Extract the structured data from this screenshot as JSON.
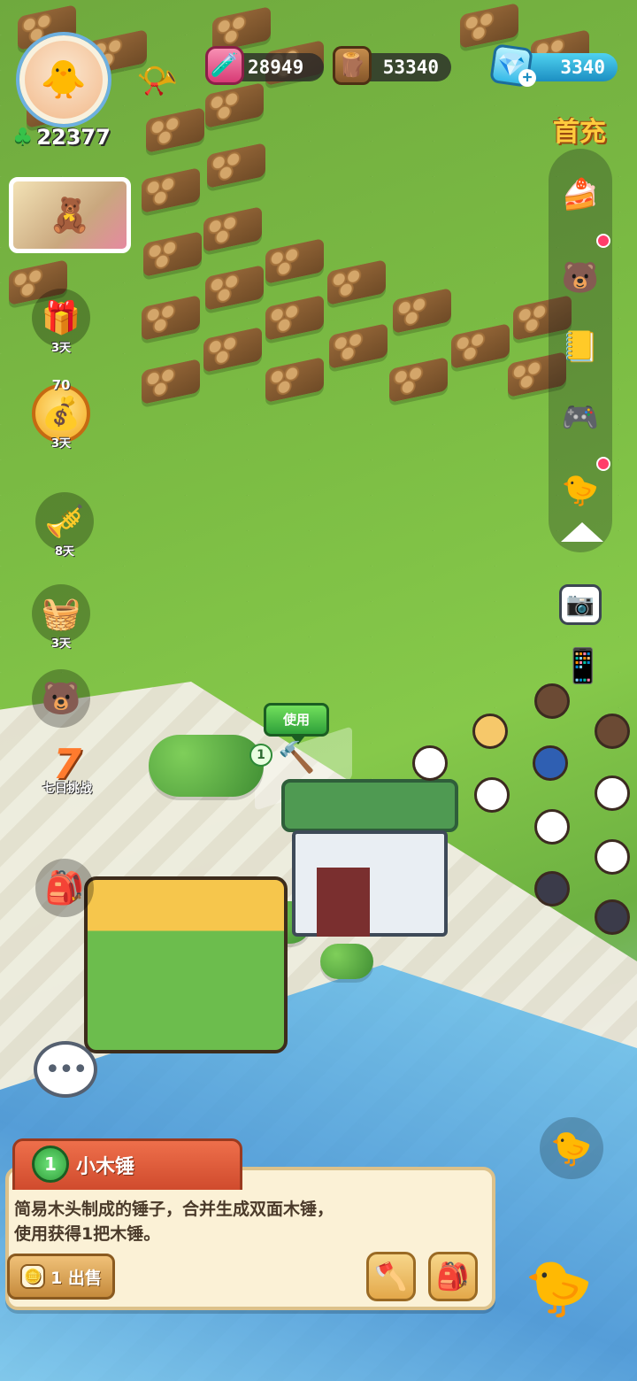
{
  "resources": {
    "jam": "28949",
    "wood": "53340",
    "gems": "3340",
    "clovers": "22377"
  },
  "icons": {
    "avatar": "🐥",
    "horn": "📯",
    "jam": "🧪",
    "wood": "🪵",
    "gem": "💎",
    "gem_plus": "+",
    "clover": "♣",
    "event_card": "🧸",
    "camera": "📷",
    "phone": "📱",
    "chat": "•••",
    "gift": "🐤",
    "flyer": "🐤",
    "hammer": "🔨",
    "sell_coin": "🪙",
    "action_craft": "🪓",
    "action_bag": "🎒"
  },
  "left_events": [
    {
      "icon": "🎁",
      "days": "3天",
      "top": ""
    },
    {
      "icon": "💰",
      "days": "3天",
      "top": "70"
    },
    {
      "icon": "🎺",
      "days": "8天",
      "top": ""
    },
    {
      "icon": "🧺",
      "days": "3天",
      "top": ""
    },
    {
      "icon": "🐻",
      "days": "",
      "top": ""
    },
    {
      "icon": "🎒",
      "days": "",
      "top": ""
    }
  ],
  "seven_day": {
    "number": "7",
    "label": "七日挑战"
  },
  "right_sidebar": {
    "recharge_label": "首充",
    "items": [
      "🍰",
      "🐻",
      "📒",
      "🎮",
      "🐤"
    ]
  },
  "world": {
    "use_label": "使用",
    "level_chip": "1"
  },
  "item_info": {
    "level": "1",
    "name": "小木锤",
    "description_line1": "简易木头制成的锤子，合并生成双面木锤，",
    "description_line2": "使用获得1把木锤。",
    "sell_label": "1 出售"
  },
  "colors": {
    "accent_green": "#2ea03a",
    "tab_red": "#d04b2d",
    "panel_bg": "#fbf1d6",
    "gem_blue": "#1c8ec2"
  }
}
